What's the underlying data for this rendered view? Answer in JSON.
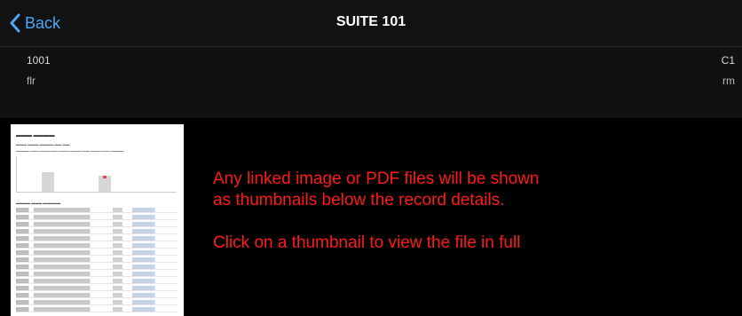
{
  "header": {
    "back_label": "Back",
    "title": "SUITE 101"
  },
  "details": {
    "unit": "1001",
    "floor_label": "flr",
    "class": "C1",
    "room_label": "rm"
  },
  "attachments": [
    {
      "type": "pdf-thumbnail"
    }
  ],
  "annotation": {
    "line1": "Any linked image or PDF files will be shown",
    "line2": "as thumbnails below the record details.",
    "line3": "Click on a thumbnail to view the file in full"
  },
  "colors": {
    "accent": "#4ea6f5",
    "annotation": "#ff1a1a",
    "background": "#000000",
    "header": "#121212"
  }
}
